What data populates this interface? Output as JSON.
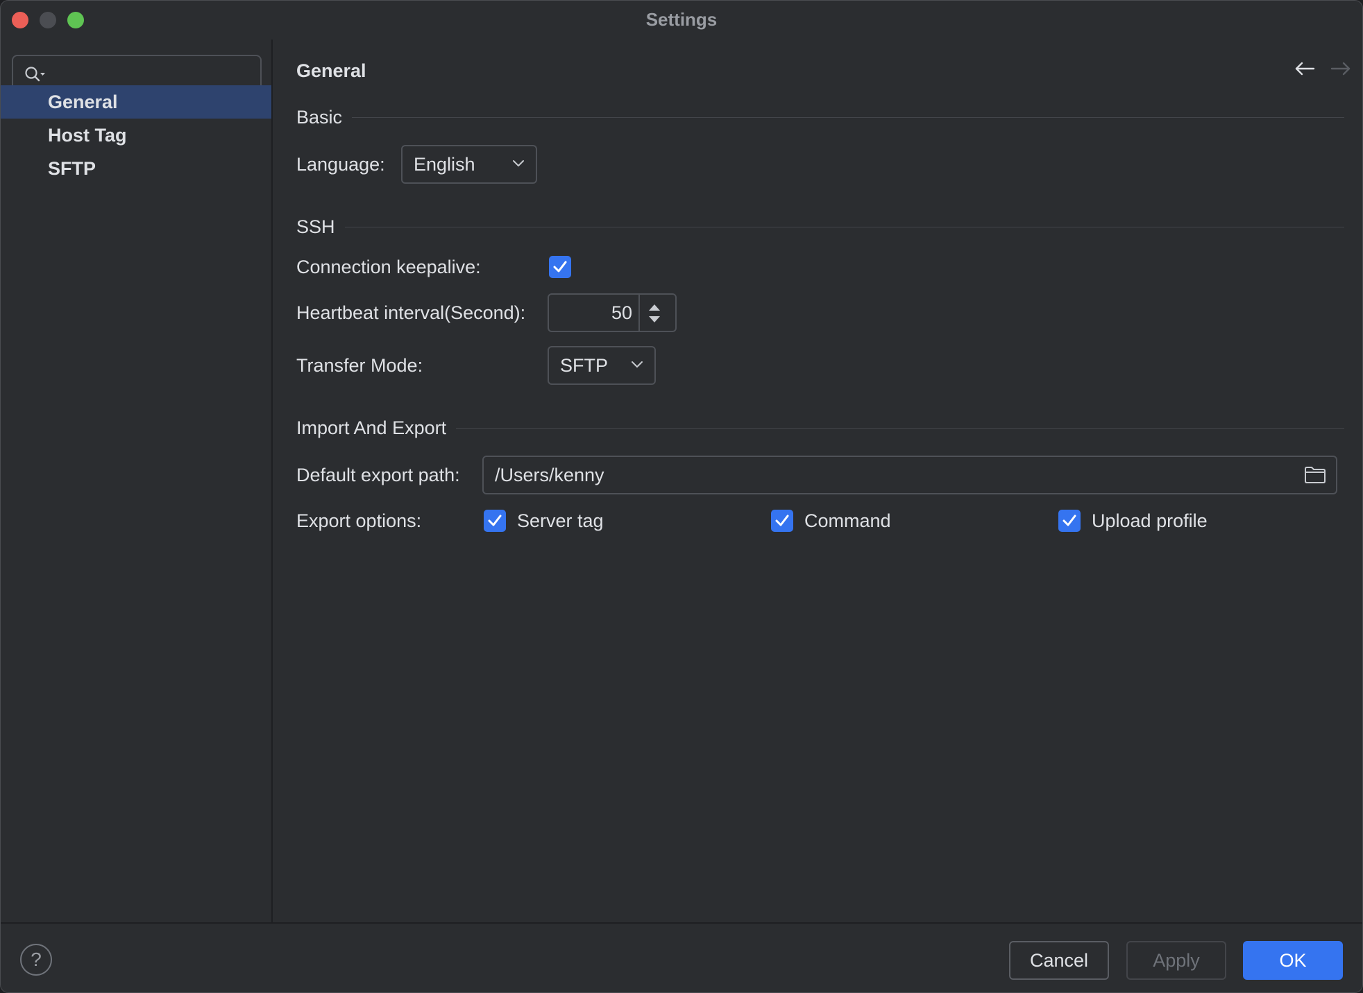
{
  "window": {
    "title": "Settings"
  },
  "sidebar": {
    "search": {
      "value": "",
      "placeholder": ""
    },
    "items": [
      {
        "label": "General",
        "selected": true
      },
      {
        "label": "Host Tag",
        "selected": false
      },
      {
        "label": "SFTP",
        "selected": false
      }
    ]
  },
  "main": {
    "page_title": "General",
    "basic": {
      "section_label": "Basic",
      "language_label": "Language:",
      "language_value": "English"
    },
    "ssh": {
      "section_label": "SSH",
      "keepalive_label": "Connection keepalive:",
      "keepalive_checked": true,
      "heartbeat_label": "Heartbeat interval(Second):",
      "heartbeat_value": "50",
      "transfer_label": "Transfer Mode:",
      "transfer_value": "SFTP"
    },
    "import_export": {
      "section_label": "Import And Export",
      "path_label": "Default export path:",
      "path_value": "/Users/kenny",
      "options_label": "Export options:",
      "options": [
        {
          "label": "Server tag",
          "checked": true
        },
        {
          "label": "Command",
          "checked": true
        },
        {
          "label": "Upload profile",
          "checked": true
        }
      ]
    }
  },
  "footer": {
    "help_label": "?",
    "cancel_label": "Cancel",
    "apply_label": "Apply",
    "ok_label": "OK"
  },
  "colors": {
    "accent": "#3574f0",
    "selected_bg": "#2e436e",
    "window_bg": "#2b2d30",
    "close": "#ec5f57",
    "maximize": "#5fc453"
  }
}
